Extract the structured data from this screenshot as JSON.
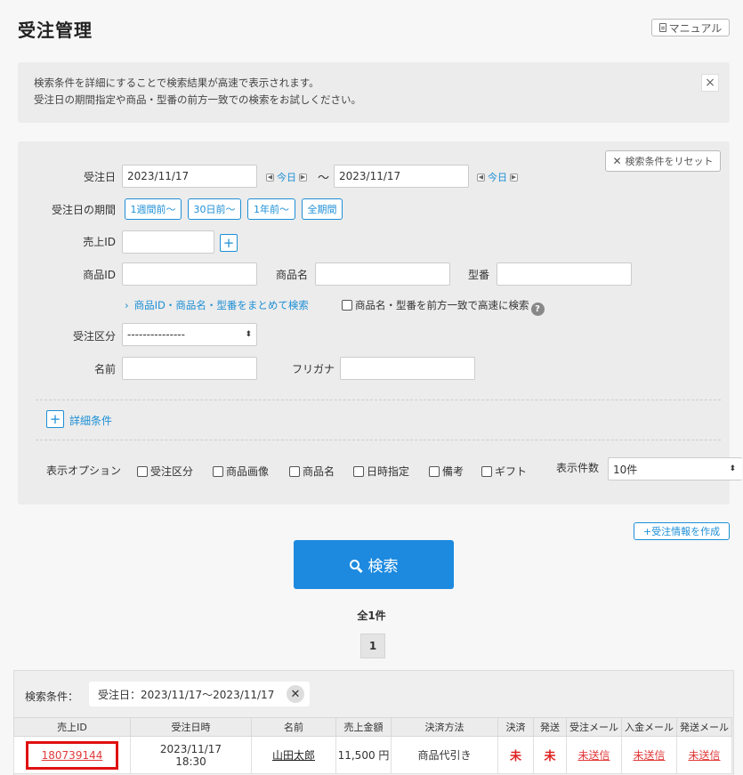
{
  "header": {
    "title": "受注管理",
    "manual_label": "マニュアル"
  },
  "notice": {
    "line1": "検索条件を詳細にすることで検索結果が高速で表示されます。",
    "line2": "受注日の期間指定や商品・型番の前方一致での検索をお試しください。",
    "close": "×"
  },
  "search_form": {
    "reset_label": "検索条件をリセット",
    "order_date_label": "受注日",
    "date_from": "2023/11/17",
    "date_to": "2023/11/17",
    "today_label": "今日",
    "tilde": "～",
    "period_label": "受注日の期間",
    "period_buttons": [
      "1週間前～",
      "30日前～",
      "1年前～",
      "全期間"
    ],
    "sales_id_label": "売上ID",
    "product_id_label": "商品ID",
    "product_name_label": "商品名",
    "model_label": "型番",
    "combined_search_link": "商品ID・商品名・型番をまとめて検索",
    "prefix_search_label": "商品名・型番を前方一致で高速に検索",
    "order_type_label": "受注区分",
    "order_type_value": "---------------",
    "name_label": "名前",
    "furigana_label": "フリガナ",
    "detail_label": "詳細条件",
    "display_options_label": "表示オプション",
    "display_options": [
      "受注区分",
      "商品画像",
      "商品名",
      "日時指定",
      "備考",
      "ギフト"
    ],
    "per_page_label": "表示件数",
    "per_page_value": "10件"
  },
  "actions": {
    "create_label": "+受注情報を作成",
    "search_label": "検索"
  },
  "pagination": {
    "total": "全1件",
    "current_page": "1"
  },
  "results": {
    "conditions_label": "検索条件：",
    "condition_chip": "受注日：2023/11/17～2023/11/17",
    "columns": [
      "売上ID",
      "受注日時",
      "名前",
      "売上金額",
      "決済方法",
      "決済",
      "発送",
      "受注メール",
      "入金メール",
      "発送メール"
    ],
    "rows": [
      {
        "sales_id": "180739144",
        "date": "2023/11/17",
        "time": "18:30",
        "name": "山田太郎",
        "amount": "11,500 円",
        "payment_method": "商品代引き",
        "payment_status": "未",
        "shipping_status": "未",
        "order_mail": "未送信",
        "payment_mail": "未送信",
        "shipping_mail": "未送信"
      }
    ]
  }
}
